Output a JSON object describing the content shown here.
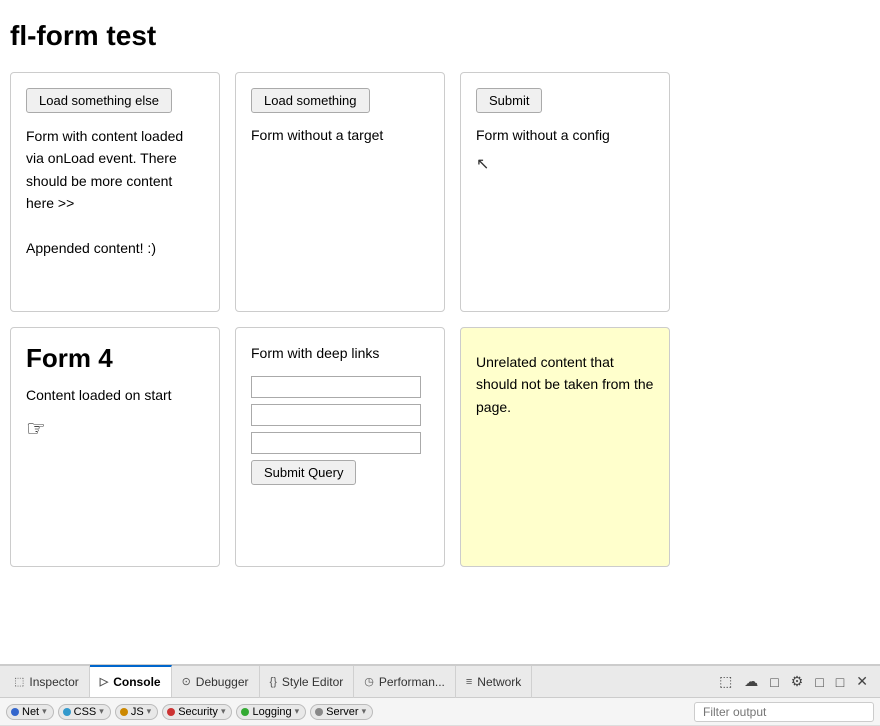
{
  "page": {
    "title": "fl-form test"
  },
  "cards_row1": [
    {
      "id": "card1",
      "button_label": "Load something else",
      "body": "Form with content loaded via onLoad event. There should be more content here >>\n\nAppended content! :)"
    },
    {
      "id": "card2",
      "button_label": "Load something",
      "label": "Form without a target"
    },
    {
      "id": "card3",
      "button_label": "Submit",
      "label": "Form without a config"
    }
  ],
  "cards_row2": [
    {
      "id": "card4",
      "title": "Form 4",
      "body": "Content loaded on start",
      "icon": "☞"
    },
    {
      "id": "card5",
      "title": "Form with deep links",
      "submit_label": "Submit Query"
    },
    {
      "id": "card6",
      "yellow": true,
      "body": "Unrelated content that should not be taken from the page."
    }
  ],
  "devtools": {
    "tabs": [
      {
        "id": "inspector",
        "label": "Inspector",
        "icon": "⬚",
        "active": false
      },
      {
        "id": "console",
        "label": "Console",
        "icon": "▷",
        "active": true
      },
      {
        "id": "debugger",
        "label": "Debugger",
        "icon": "⊙",
        "active": false
      },
      {
        "id": "style-editor",
        "label": "Style Editor",
        "icon": "{}",
        "active": false
      },
      {
        "id": "performance",
        "label": "Performan...",
        "icon": "◷",
        "active": false
      },
      {
        "id": "network",
        "label": "Network",
        "icon": "≡",
        "active": false
      }
    ],
    "toolbar_icons": [
      "⬚",
      "☁",
      "□",
      "⚙",
      "□",
      "□",
      "✕"
    ],
    "filters": [
      {
        "id": "net",
        "label": "Net",
        "color": "#3366cc",
        "dot_color": "#3366cc"
      },
      {
        "id": "css",
        "label": "CSS",
        "color": "#3399cc",
        "dot_color": "#3399cc"
      },
      {
        "id": "js",
        "label": "JS",
        "color": "#cc8800",
        "dot_color": "#cc8800"
      },
      {
        "id": "security",
        "label": "Security",
        "color": "#cc3333",
        "dot_color": "#cc3333"
      },
      {
        "id": "logging",
        "label": "Logging",
        "color": "#33aa33",
        "dot_color": "#33aa33"
      },
      {
        "id": "server",
        "label": "Server",
        "color": "#888",
        "dot_color": "#888"
      }
    ],
    "filter_output_placeholder": "Filter output"
  }
}
